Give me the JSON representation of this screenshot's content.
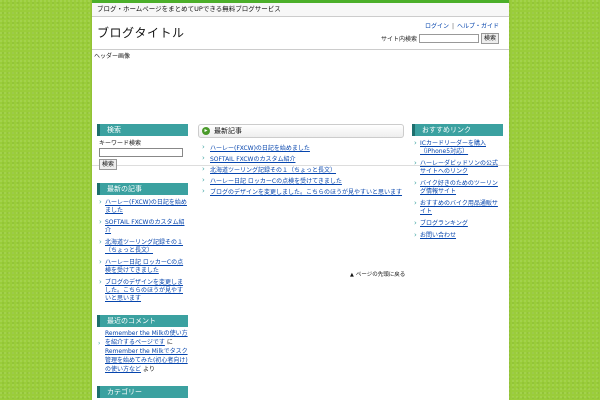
{
  "top_line": "ブログ・ホームページをまとめてUPできる無料ブログサービス",
  "site_title": "ブログタイトル",
  "header_links": [
    "ログイン",
    "ヘルプ・ガイド"
  ],
  "header_search": {
    "label": "サイト内検索",
    "button": "検索"
  },
  "banner_text": "ヘッダー画像",
  "left": {
    "search": {
      "title": "検索",
      "label": "キーワード検索",
      "button": "検索"
    },
    "recent": {
      "title": "最新の記事",
      "items": [
        "ハーレー(FXCW)の日記を始めました",
        "SOFTAIL FXCWのカスタム紹介",
        "北海道ツーリング記録その１（ちょっと長文）",
        "ハーレー日記 ロッカーCの点検を受けてきました",
        "ブログのデザインを変更しました。こちらのほうが見やすいと思います"
      ]
    },
    "comments": {
      "title": "最近のコメント",
      "item": {
        "link1": "Remember the Milkの使い方を紹介するページです",
        "mid": "に",
        "link2": "Remember the Milkでタスク管理を始めてみた(初心者向け)の使い方など",
        "suffix": "より"
      }
    },
    "archive": {
      "title": "カテゴリー"
    }
  },
  "main": {
    "title": "最新記事",
    "items": [
      "ハーレー(FXCW)の日記を始めました",
      "SOFTAIL FXCWのカスタム紹介",
      "北海道ツーリング記録その１（ちょっと長文）",
      "ハーレー日記 ロッカーCの点検を受けてきました",
      "ブログのデザインを変更しました。こちらのほうが見やすいと思います"
    ],
    "pagetop": "ページの先頭に戻る"
  },
  "right": {
    "title": "おすすめリンク",
    "items": [
      "ICカードリーダーを購入（iPhone5対応）",
      "ハーレーダビッドソンの公式サイトへのリンク",
      "バイク好きのためのツーリング情報サイト",
      "おすすめのバイク用品通販サイト",
      "ブログランキング",
      "お問い合わせ"
    ]
  }
}
